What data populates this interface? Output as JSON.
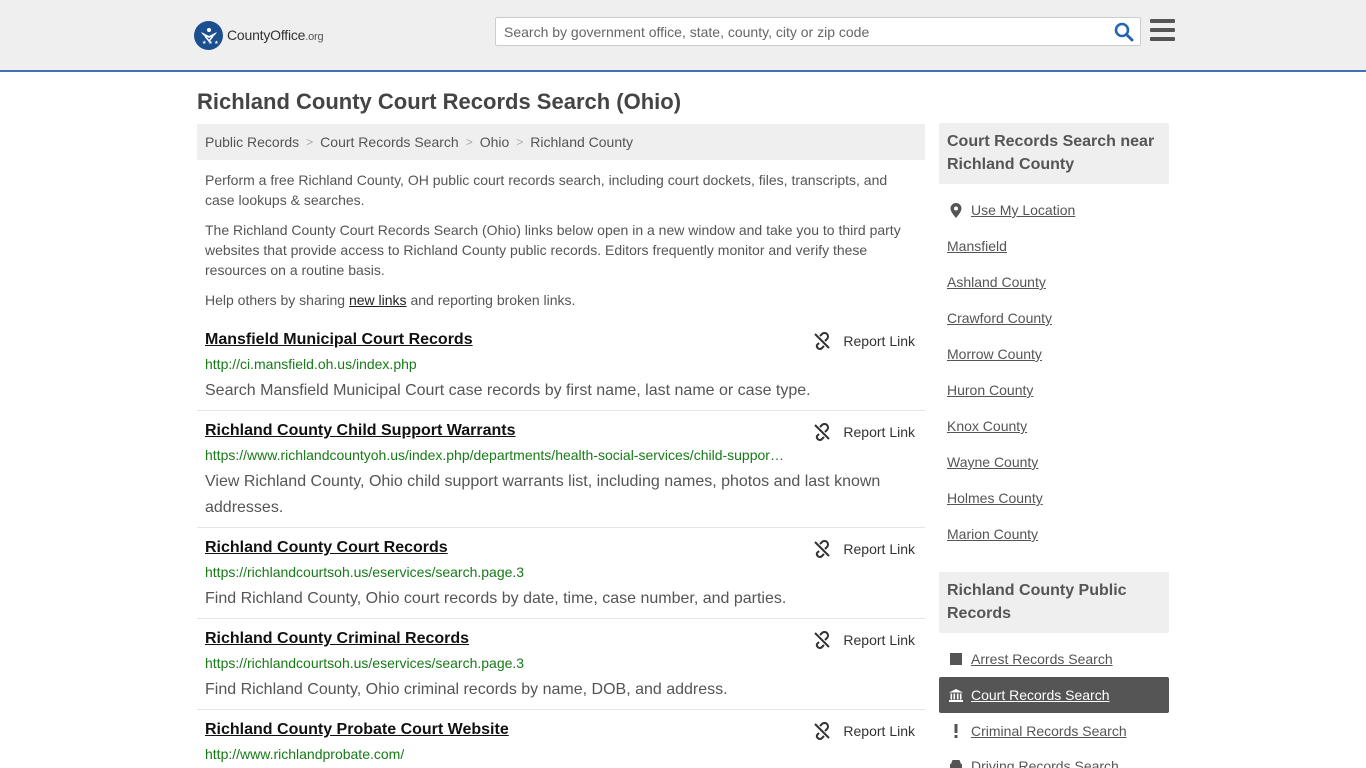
{
  "header": {
    "logo_main": "CountyOffice",
    "logo_suffix": ".org",
    "search_placeholder": "Search by government office, state, county, city or zip code"
  },
  "page": {
    "title": "Richland County Court Records Search (Ohio)"
  },
  "breadcrumb": [
    "Public Records",
    "Court Records Search",
    "Ohio",
    "Richland County"
  ],
  "intro": {
    "p1": "Perform a free Richland County, OH public court records search, including court dockets, files, transcripts, and case lookups & searches.",
    "p2": "The Richland County Court Records Search (Ohio) links below open in a new window and take you to third party websites that provide access to Richland County public records. Editors frequently monitor and verify these resources on a routine basis.",
    "p3_before": "Help others by sharing ",
    "p3_link": "new links",
    "p3_after": " and reporting broken links."
  },
  "report_label": "Report Link",
  "results": [
    {
      "title": "Mansfield Municipal Court Records",
      "url": "http://ci.mansfield.oh.us/index.php",
      "desc": "Search Mansfield Municipal Court case records by first name, last name or case type."
    },
    {
      "title": "Richland County Child Support Warrants",
      "url": "https://www.richlandcountyoh.us/index.php/departments/health-social-services/child-support-enforcement-agency/child-support-warrants",
      "desc": "View Richland County, Ohio child support warrants list, including names, photos and last known addresses."
    },
    {
      "title": "Richland County Court Records",
      "url": "https://richlandcourtsoh.us/eservices/search.page.3",
      "desc": "Find Richland County, Ohio court records by date, time, case number, and parties."
    },
    {
      "title": "Richland County Criminal Records",
      "url": "https://richlandcourtsoh.us/eservices/search.page.3",
      "desc": "Find Richland County, Ohio criminal records by name, DOB, and address."
    },
    {
      "title": "Richland County Probate Court Website",
      "url": "http://www.richlandprobate.com/",
      "desc": ""
    }
  ],
  "sidebar": {
    "nearby_heading": "Court Records Search near Richland County",
    "use_location": "Use My Location",
    "nearby": [
      "Mansfield",
      "Ashland County",
      "Crawford County",
      "Morrow County",
      "Huron County",
      "Knox County",
      "Wayne County",
      "Holmes County",
      "Marion County"
    ],
    "public_heading": "Richland County Public Records",
    "public_records": [
      {
        "label": "Arrest Records Search",
        "icon": "square-icon",
        "active": false
      },
      {
        "label": "Court Records Search",
        "icon": "courthouse-icon",
        "active": true
      },
      {
        "label": "Criminal Records Search",
        "icon": "exclamation-icon",
        "active": false
      },
      {
        "label": "Driving Records Search",
        "icon": "car-icon",
        "active": false
      }
    ]
  },
  "colors": {
    "accent_blue": "#3c73b5",
    "url_green": "#177a17",
    "active_bg": "#555555"
  }
}
